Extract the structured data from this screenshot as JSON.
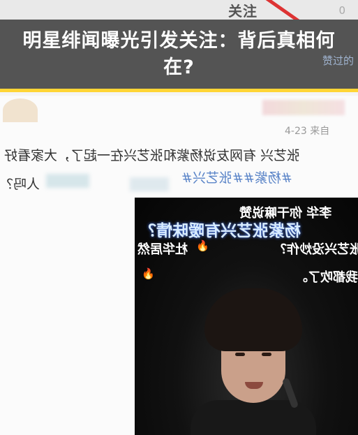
{
  "headline": {
    "text": "明星绯闻曝光引发关注：背后真相何在?"
  },
  "top": {
    "tab_label": "关注",
    "ghost_label": "0"
  },
  "side_link": "赞过的",
  "post": {
    "meta": "4-23 来自",
    "text": "张艺兴 有网友说杨紫和张艺兴在一起了，大家看好",
    "tags": "#杨紫##张艺兴#",
    "tail": "人吗？"
  },
  "video": {
    "comments": [
      "杨紫张艺兴有暧昧情？",
      "李华 你干嘛说赞",
      "杜华居然",
      "杨紫张艺兴没炒作？",
      "我都吹了。"
    ],
    "flame_icon": "🔥"
  },
  "colors": {
    "banner": "#545454",
    "accent": "#ffd535",
    "link": "#5b85c8"
  }
}
